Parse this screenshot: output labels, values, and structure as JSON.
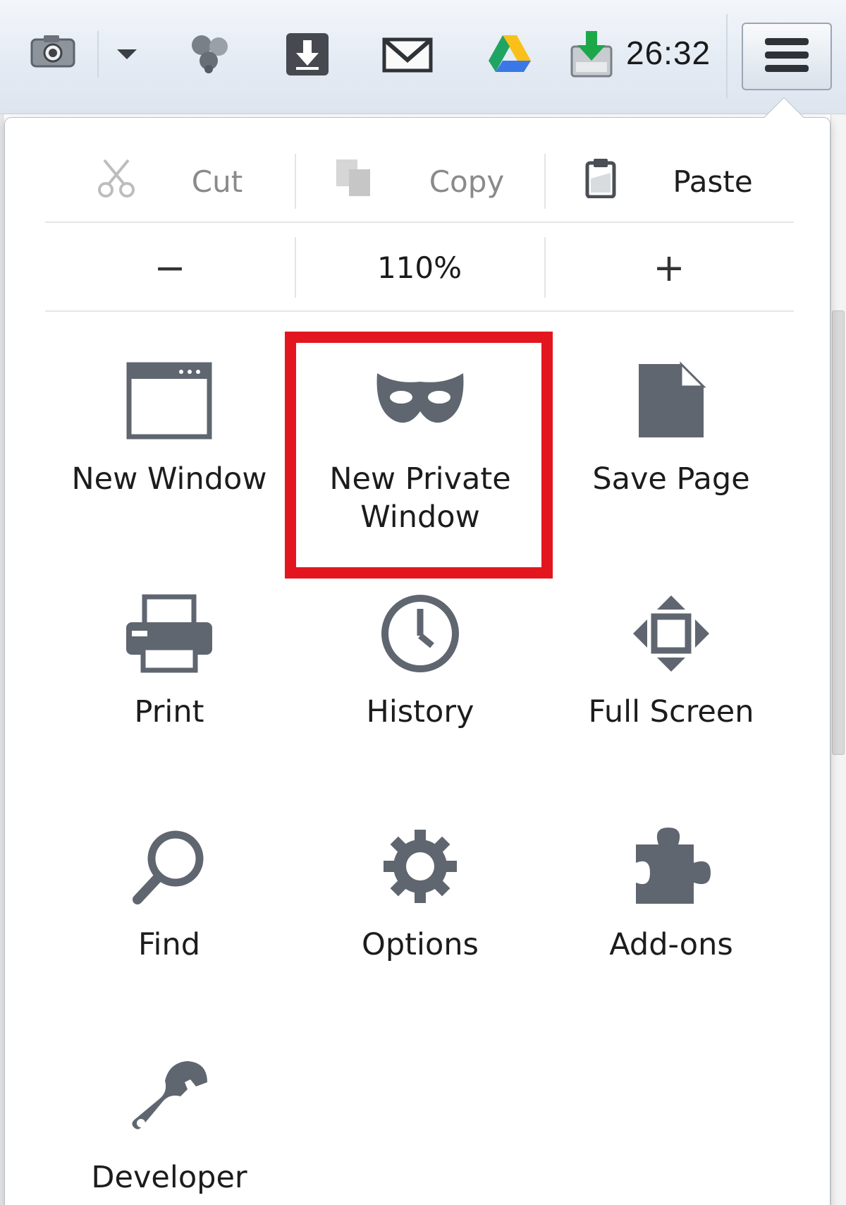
{
  "toolbar": {
    "clock": "26:32",
    "icons": [
      "screenshot-camera-icon",
      "dropdown-arrow-icon",
      "addon-share-icon",
      "download-arrow-icon",
      "gmail-envelope-icon",
      "google-drive-icon",
      "download-status-icon"
    ],
    "menu_icon": "hamburger-menu-icon"
  },
  "edit": {
    "cut_label": "Cut",
    "copy_label": "Copy",
    "paste_label": "Paste"
  },
  "zoom": {
    "minus_label": "−",
    "level": "110%",
    "plus_label": "+"
  },
  "tiles": [
    {
      "label": "New Window",
      "icon": "window-icon"
    },
    {
      "label": "New Private Window",
      "icon": "private-mask-icon"
    },
    {
      "label": "Save Page",
      "icon": "page-icon"
    },
    {
      "label": "Print",
      "icon": "printer-icon"
    },
    {
      "label": "History",
      "icon": "clock-icon"
    },
    {
      "label": "Full Screen",
      "icon": "fullscreen-icon"
    },
    {
      "label": "Find",
      "icon": "magnifier-icon"
    },
    {
      "label": "Options",
      "icon": "gear-icon"
    },
    {
      "label": "Add-ons",
      "icon": "puzzle-icon"
    },
    {
      "label": "Developer",
      "icon": "wrench-icon"
    }
  ],
  "colors": {
    "icon_gray": "#5f6670",
    "highlight": "#e3161f"
  }
}
